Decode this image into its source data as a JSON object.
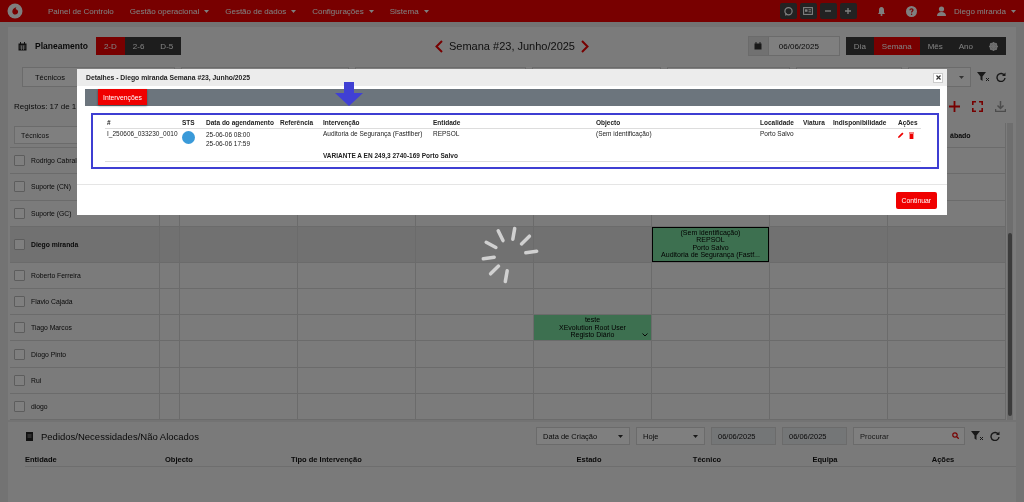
{
  "navbar": {
    "menu": [
      {
        "label": "Painel de Controlo",
        "dropdown": false
      },
      {
        "label": "Gestão operacional",
        "dropdown": true
      },
      {
        "label": "Gestão de dados",
        "dropdown": true
      },
      {
        "label": "Configurações",
        "dropdown": true
      },
      {
        "label": "Sistema",
        "dropdown": true
      }
    ],
    "user": "Diego miranda"
  },
  "planning": {
    "title": "Planeamento",
    "range_buttons": [
      {
        "label": "2-D",
        "selected": true
      },
      {
        "label": "2-6",
        "selected": false
      },
      {
        "label": "D-5",
        "selected": false
      }
    ],
    "week": "Semana #23, Junho/2025",
    "date": "06/06/2025",
    "views": [
      {
        "label": "Dia",
        "selected": false
      },
      {
        "label": "Semana",
        "selected": true
      },
      {
        "label": "Mês",
        "selected": false
      },
      {
        "label": "Ano",
        "selected": false
      }
    ],
    "technicians_filter": "Técnicos",
    "records": "Registos: 17 de 1"
  },
  "grid": {
    "name_filter": {
      "placeholder": "Técnicos"
    },
    "day_header": "ábado",
    "rows": [
      {
        "name": "Rodrigo Cabral",
        "selected": false,
        "checked": false,
        "days": [
          {
            "kind": "empty"
          },
          {
            "kind": "empty"
          },
          {
            "kind": "empty"
          },
          {
            "kind": "empty"
          },
          {
            "kind": "empty"
          },
          {
            "kind": "empty"
          },
          {
            "kind": "empty"
          }
        ]
      },
      {
        "name": "Suporte (CN)",
        "selected": false,
        "checked": false,
        "days": [
          {
            "kind": "empty"
          },
          {
            "kind": "empty"
          },
          {
            "kind": "empty"
          },
          {
            "kind": "empty"
          },
          {
            "kind": "empty"
          },
          {
            "kind": "empty"
          },
          {
            "kind": "empty"
          }
        ]
      },
      {
        "name": "Suporte (GC)",
        "selected": false,
        "checked": false,
        "days": [
          {
            "kind": "empty"
          },
          {
            "kind": "empty"
          },
          {
            "kind": "empty"
          },
          {
            "kind": "empty"
          },
          {
            "kind": "empty"
          },
          {
            "kind": "empty"
          },
          {
            "kind": "empty"
          }
        ]
      },
      {
        "name": "Diego miranda",
        "selected": true,
        "checked": false,
        "days": [
          {
            "kind": "empty"
          },
          {
            "kind": "empty"
          },
          {
            "kind": "empty"
          },
          {
            "kind": "empty"
          },
          {
            "kind": "event",
            "selected": true,
            "lines": [
              "(Sem identificação)",
              "REPSOL",
              "Porto Salvo",
              "Auditoria de Segurança (Fastf..."
            ]
          },
          {
            "kind": "empty"
          },
          {
            "kind": "empty"
          }
        ]
      },
      {
        "name": "Roberto Ferreira",
        "selected": false,
        "checked": false,
        "days": [
          {
            "kind": "empty"
          },
          {
            "kind": "empty"
          },
          {
            "kind": "empty"
          },
          {
            "kind": "empty"
          },
          {
            "kind": "empty"
          },
          {
            "kind": "empty"
          },
          {
            "kind": "empty"
          }
        ]
      },
      {
        "name": "Flavio Cajada",
        "selected": false,
        "checked": false,
        "days": [
          {
            "kind": "empty"
          },
          {
            "kind": "empty"
          },
          {
            "kind": "empty"
          },
          {
            "kind": "empty"
          },
          {
            "kind": "empty"
          },
          {
            "kind": "empty"
          },
          {
            "kind": "empty"
          }
        ]
      },
      {
        "name": "Tiago Marcos",
        "selected": false,
        "checked": false,
        "days": [
          {
            "kind": "empty"
          },
          {
            "kind": "empty"
          },
          {
            "kind": "empty"
          },
          {
            "kind": "event",
            "selected": false,
            "lines": [
              "teste",
              "XEvolution Root User",
              "Registo Diário"
            ]
          },
          {
            "kind": "empty"
          },
          {
            "kind": "empty"
          },
          {
            "kind": "empty"
          }
        ]
      },
      {
        "name": "Diogo Pinto",
        "selected": false,
        "checked": false,
        "days": [
          {
            "kind": "empty"
          },
          {
            "kind": "empty"
          },
          {
            "kind": "empty"
          },
          {
            "kind": "empty"
          },
          {
            "kind": "empty"
          },
          {
            "kind": "empty"
          },
          {
            "kind": "empty"
          }
        ]
      },
      {
        "name": "Rui",
        "selected": false,
        "checked": false,
        "days": [
          {
            "kind": "empty"
          },
          {
            "kind": "empty"
          },
          {
            "kind": "empty"
          },
          {
            "kind": "empty"
          },
          {
            "kind": "empty"
          },
          {
            "kind": "empty"
          },
          {
            "kind": "empty"
          }
        ]
      },
      {
        "name": "diogo",
        "selected": false,
        "checked": false,
        "days": [
          {
            "kind": "empty"
          },
          {
            "kind": "empty"
          },
          {
            "kind": "empty"
          },
          {
            "kind": "empty"
          },
          {
            "kind": "empty"
          },
          {
            "kind": "empty"
          },
          {
            "kind": "empty"
          }
        ]
      }
    ]
  },
  "pending": {
    "title": "Pedidos/Necessidades/Não Alocados",
    "date_type": "Data de Criação",
    "period": "Hoje",
    "date_from": "06/06/2025",
    "date_to": "06/06/2025",
    "search": {
      "placeholder": "Procurar"
    },
    "columns": [
      "Entidade",
      "Objecto",
      "Tipo de Intervenção",
      "Estado",
      "Técnico",
      "Equipa",
      "Ações"
    ]
  },
  "modal": {
    "title": "Detalhes - Diego miranda Semana #23, Junho/2025",
    "tabs": [
      {
        "label": "Intervenções",
        "selected": true
      }
    ],
    "columns": [
      "#",
      "STS",
      "Data do agendamento",
      "Referência",
      "Intervenção",
      "Entidade",
      "Objecto",
      "Localidade",
      "Viatura",
      "Indisponibilidade",
      "Ações"
    ],
    "rows": [
      {
        "id": "I_250606_033230_0010",
        "color": "#3a9ad9",
        "start": "25-06-06 08:00",
        "end": "25-06-06 17:59",
        "intervention": "Auditoria de Segurança (Fastfiber)",
        "entity": "REPSOL",
        "object": "(Sem identificação)",
        "location": "Porto Salvo",
        "address": "VARIANTE A EN 249,3 2740-169 Porto Salvo"
      }
    ],
    "continue": "Continuar"
  }
}
